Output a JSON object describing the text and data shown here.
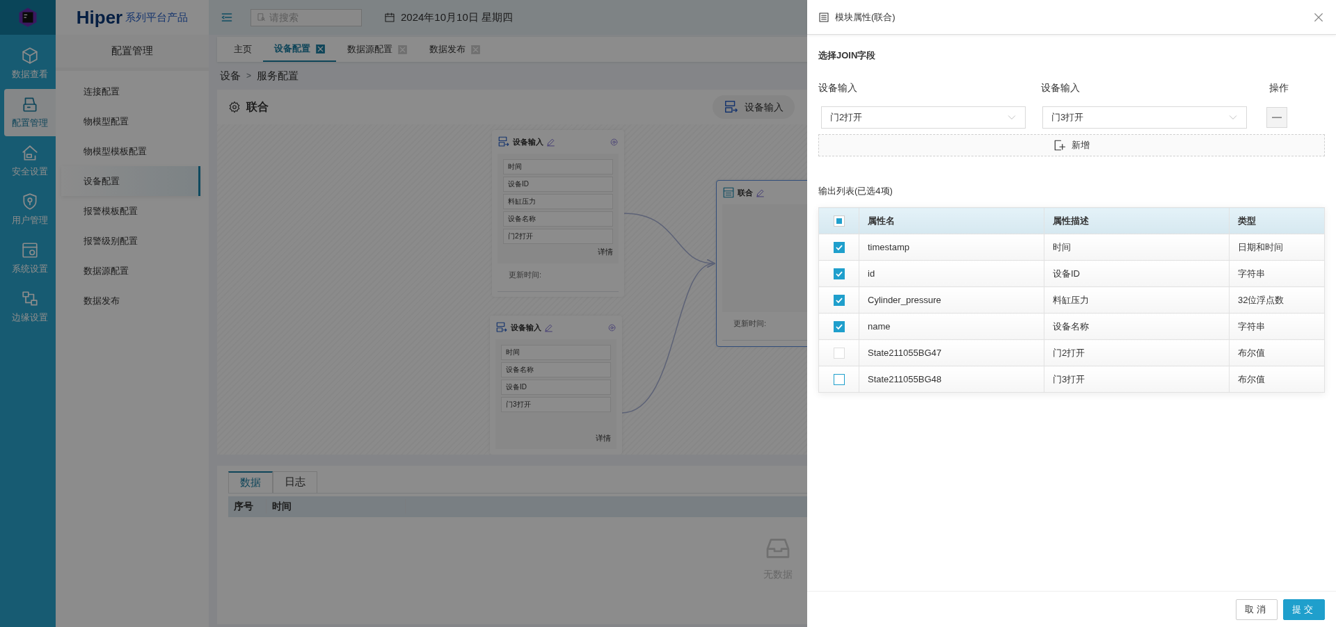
{
  "rail": {
    "items": [
      {
        "kind": "cube",
        "label": "数据查看",
        "selected": false
      },
      {
        "kind": "device",
        "label": "配置管理",
        "selected": true
      },
      {
        "kind": "house",
        "label": "安全设置",
        "selected": false
      },
      {
        "kind": "shield",
        "label": "用户管理",
        "selected": false
      },
      {
        "kind": "browser",
        "label": "系统设置",
        "selected": false
      },
      {
        "kind": "network",
        "label": "边缘设置",
        "selected": false
      }
    ]
  },
  "brand": {
    "name": "Hiper",
    "suffix": "系列平台产品"
  },
  "menu": {
    "title": "配置管理",
    "items": [
      {
        "label": "连接配置",
        "selected": false
      },
      {
        "label": "物模型配置",
        "selected": false
      },
      {
        "label": "物模型模板配置",
        "selected": false
      },
      {
        "label": "设备配置",
        "selected": true
      },
      {
        "label": "报警模板配置",
        "selected": false
      },
      {
        "label": "报警级别配置",
        "selected": false
      },
      {
        "label": "数据源配置",
        "selected": false
      },
      {
        "label": "数据发布",
        "selected": false
      }
    ]
  },
  "header": {
    "search_placeholder": "请搜索",
    "date": "2024年10月10日 星期四"
  },
  "tabs": [
    {
      "label": "主页",
      "selected": false,
      "closable": false
    },
    {
      "label": "设备配置",
      "selected": true,
      "closable": true
    },
    {
      "label": "数据源配置",
      "selected": false,
      "closable": true
    },
    {
      "label": "数据发布",
      "selected": false,
      "closable": true
    }
  ],
  "breadcrumb": {
    "items": [
      "设备",
      "服务配置"
    ],
    "separator": ">"
  },
  "canvas": {
    "title": "联合",
    "toolbar_item": "设备输入",
    "nodes": [
      {
        "kind": "input",
        "title": "设备输入",
        "fields": [
          "时间",
          "设备ID",
          "料缸压力",
          "设备名称",
          "门2打开"
        ],
        "detail": "详情",
        "update_label": "更新时间:"
      },
      {
        "kind": "input",
        "title": "设备输入",
        "fields": [
          "时间",
          "设备名称",
          "设备ID",
          "门3打开"
        ],
        "detail": "详情"
      },
      {
        "kind": "join",
        "title": "联合",
        "update_label": "更新时间:"
      }
    ]
  },
  "bottom": {
    "tabs": [
      {
        "label": "数据",
        "selected": true
      },
      {
        "label": "日志",
        "selected": false
      }
    ],
    "columns": [
      "序号",
      "时间"
    ],
    "empty": "无数据"
  },
  "drawer": {
    "title": "模块属性(联合)",
    "section": "选择JOIN字段",
    "join_columns": [
      "设备输入",
      "设备输入",
      "操作"
    ],
    "join_rows": [
      {
        "left": "门2打开",
        "right": "门3打开"
      }
    ],
    "add": "新增",
    "output_title": "输出列表(已选4项)",
    "header_indeterminate": true,
    "columns": [
      "属性名",
      "属性描述",
      "类型"
    ],
    "rows": [
      {
        "name": "timestamp",
        "desc": "时间",
        "type": "日期和时间",
        "checked": true,
        "disabled": false
      },
      {
        "name": "id",
        "desc": "设备ID",
        "type": "字符串",
        "checked": true,
        "disabled": false
      },
      {
        "name": "Cylinder_pressure",
        "desc": "料缸压力",
        "type": "32位浮点数",
        "checked": true,
        "disabled": false
      },
      {
        "name": "name",
        "desc": "设备名称",
        "type": "字符串",
        "checked": true,
        "disabled": false
      },
      {
        "name": "State211055BG47",
        "desc": "门2打开",
        "type": "布尔值",
        "checked": false,
        "disabled": true
      },
      {
        "name": "State211055BG48",
        "desc": "门3打开",
        "type": "布尔值",
        "checked": false,
        "disabled": false
      }
    ],
    "buttons": [
      {
        "label": "取消",
        "kind": "secondary"
      },
      {
        "label": "提交",
        "kind": "primary"
      }
    ]
  }
}
